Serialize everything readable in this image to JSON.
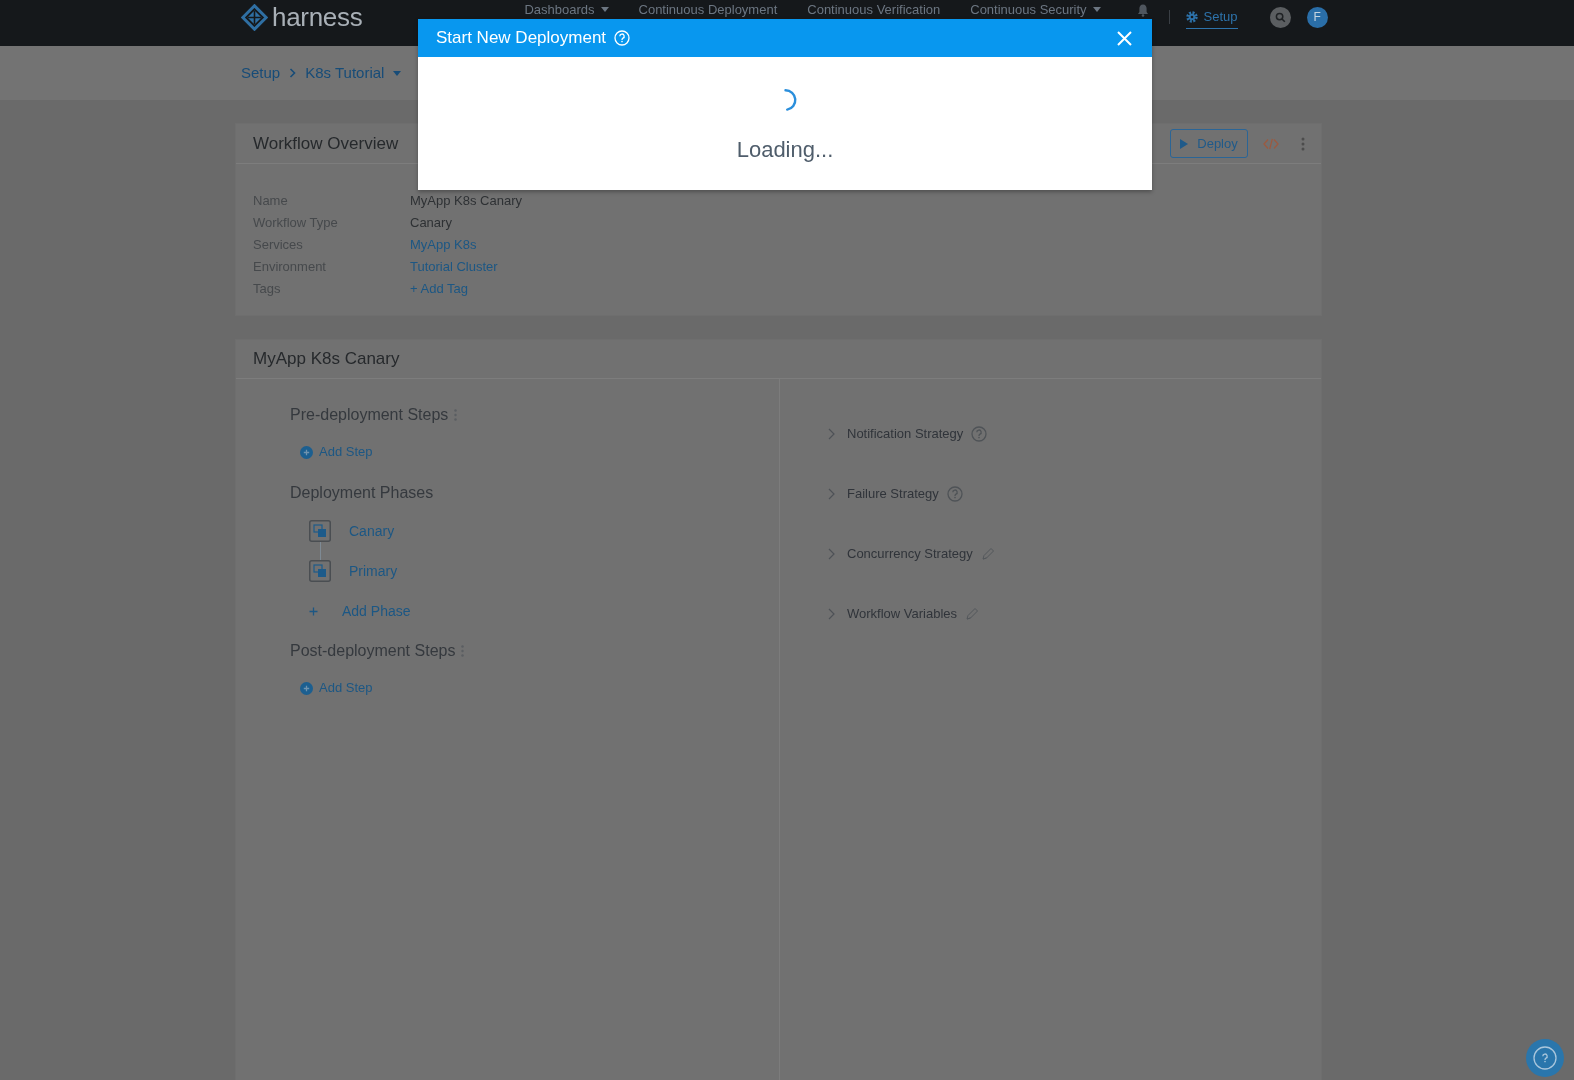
{
  "top_nav": {
    "logo": "harness",
    "menu": [
      {
        "label": "Dashboards",
        "dropdown": true,
        "selected": false
      },
      {
        "label": "Continuous Deployment",
        "dropdown": false,
        "selected": false
      },
      {
        "label": "Continuous Verification",
        "dropdown": false,
        "selected": false
      },
      {
        "label": "Continuous Security",
        "dropdown": true,
        "selected": false
      }
    ],
    "setup": {
      "label": "Setup",
      "selected": true
    },
    "avatar": "F"
  },
  "breadcrumb": [
    {
      "label": "Setup",
      "dropdown": false
    },
    {
      "label": "K8s Tutorial",
      "dropdown": true
    }
  ],
  "overview": {
    "title": "Workflow Overview",
    "deploy_button": "Deploy",
    "fields": [
      {
        "label": "Name",
        "value": "MyApp K8s Canary",
        "kind": "text"
      },
      {
        "label": "Workflow Type",
        "value": "Canary",
        "kind": "text"
      },
      {
        "label": "Services",
        "value": "MyApp K8s",
        "kind": "link"
      },
      {
        "label": "Environment",
        "value": "Tutorial Cluster",
        "kind": "link"
      },
      {
        "label": "Tags",
        "value": "+ Add Tag",
        "kind": "link"
      }
    ]
  },
  "workflow": {
    "title": "MyApp K8s Canary",
    "sections": [
      {
        "kind": "steps",
        "title": "Pre-deployment Steps",
        "add_label": "Add Step"
      },
      {
        "kind": "phases",
        "title": "Deployment Phases",
        "phases": [
          {
            "name": "Canary"
          },
          {
            "name": "Primary"
          }
        ],
        "add_label": "Add Phase"
      },
      {
        "kind": "steps",
        "title": "Post-deployment Steps",
        "add_label": "Add Step"
      }
    ],
    "strategies": [
      {
        "label": "Notification Strategy",
        "kind": "help",
        "expanded": false
      },
      {
        "label": "Failure Strategy",
        "kind": "help",
        "expanded": false
      },
      {
        "label": "Concurrency Strategy",
        "kind": "edit",
        "expanded": false
      },
      {
        "label": "Workflow Variables",
        "kind": "edit",
        "expanded": false
      }
    ]
  },
  "modal": {
    "title": "Start New Deployment",
    "loading_text": "Loading..."
  }
}
